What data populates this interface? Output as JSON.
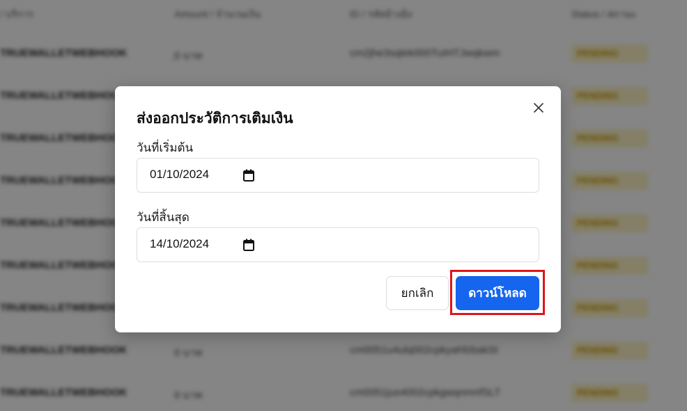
{
  "background_table": {
    "headers": [
      "/ บริการ",
      "Amount / จำนวนเงิน",
      "ID / รหัสอ้างอิง",
      "Status / สถานะ"
    ],
    "rows": [
      {
        "service": "TRUEWALLETWEBHOOK",
        "amount": "ฺ0 บาท",
        "ref": "cm2jhe3sqlek000TuIHTJwqkwm",
        "status": "PENDING"
      },
      {
        "service": "TRUEWALLETWEBHOOK",
        "amount": "",
        "ref": "",
        "status": "PENDING"
      },
      {
        "service": "TRUEWALLETWEBHOOK",
        "amount": "",
        "ref": "",
        "status": "PENDING"
      },
      {
        "service": "TRUEWALLETWEBHOOK",
        "amount": "",
        "ref": "",
        "status": "PENDING"
      },
      {
        "service": "TRUEWALLETWEBHOOK",
        "amount": "",
        "ref": "",
        "status": "PENDING"
      },
      {
        "service": "TRUEWALLETWEBHOOK",
        "amount": "",
        "ref": "",
        "status": "PENDING"
      },
      {
        "service": "TRUEWALLETWEBHOOK",
        "amount": "",
        "ref": "",
        "status": "PENDING"
      },
      {
        "service": "TRUEWALLETWEBHOOK",
        "amount": "0 บาท",
        "ref": "cm0051u4ulq002cpkyahfzbakSt",
        "status": "PENDING"
      },
      {
        "service": "TRUEWALLETWEBHOOK",
        "amount": "0 บาท",
        "ref": "cm0051jus4002cpkgwqnmnfSLT",
        "status": "PENDING"
      }
    ]
  },
  "modal": {
    "title": "ส่งออกประวัติการเติมเงิน",
    "start_label": "วันที่เริ่มต้น",
    "start_value": "01/10/2024",
    "end_label": "วันที่สิ้นสุด",
    "end_value": "14/10/2024",
    "cancel_label": "ยกเลิก",
    "download_label": "ดาวน์โหลด"
  },
  "colors": {
    "primary": "#1565ee",
    "highlight": "#e0141b",
    "pending_bg": "#fdf3c4",
    "pending_fg": "#c99a00"
  },
  "icons": {
    "close": "close-icon",
    "calendar": "calendar-icon"
  }
}
